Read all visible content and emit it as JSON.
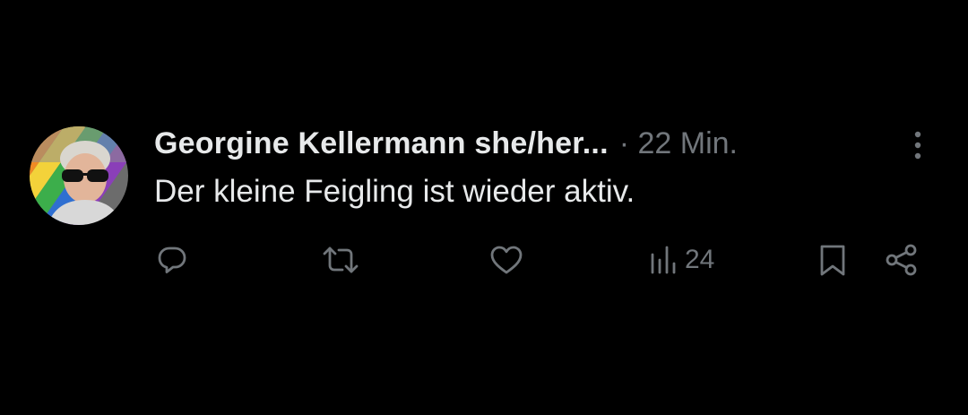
{
  "tweet": {
    "display_name": "Georgine Kellermann she/her...",
    "meta": "· 22 Min.",
    "text": "Der kleine Feigling ist wieder aktiv.",
    "views_count": "24"
  },
  "icons": {
    "more": "more-vertical-icon",
    "reply": "reply-icon",
    "retweet": "retweet-icon",
    "like": "heart-icon",
    "views": "views-chart-icon",
    "bookmark": "bookmark-icon",
    "share": "share-icon"
  },
  "colors": {
    "background": "#000000",
    "primary_text": "#e7e9ea",
    "secondary_text": "#71767b"
  }
}
